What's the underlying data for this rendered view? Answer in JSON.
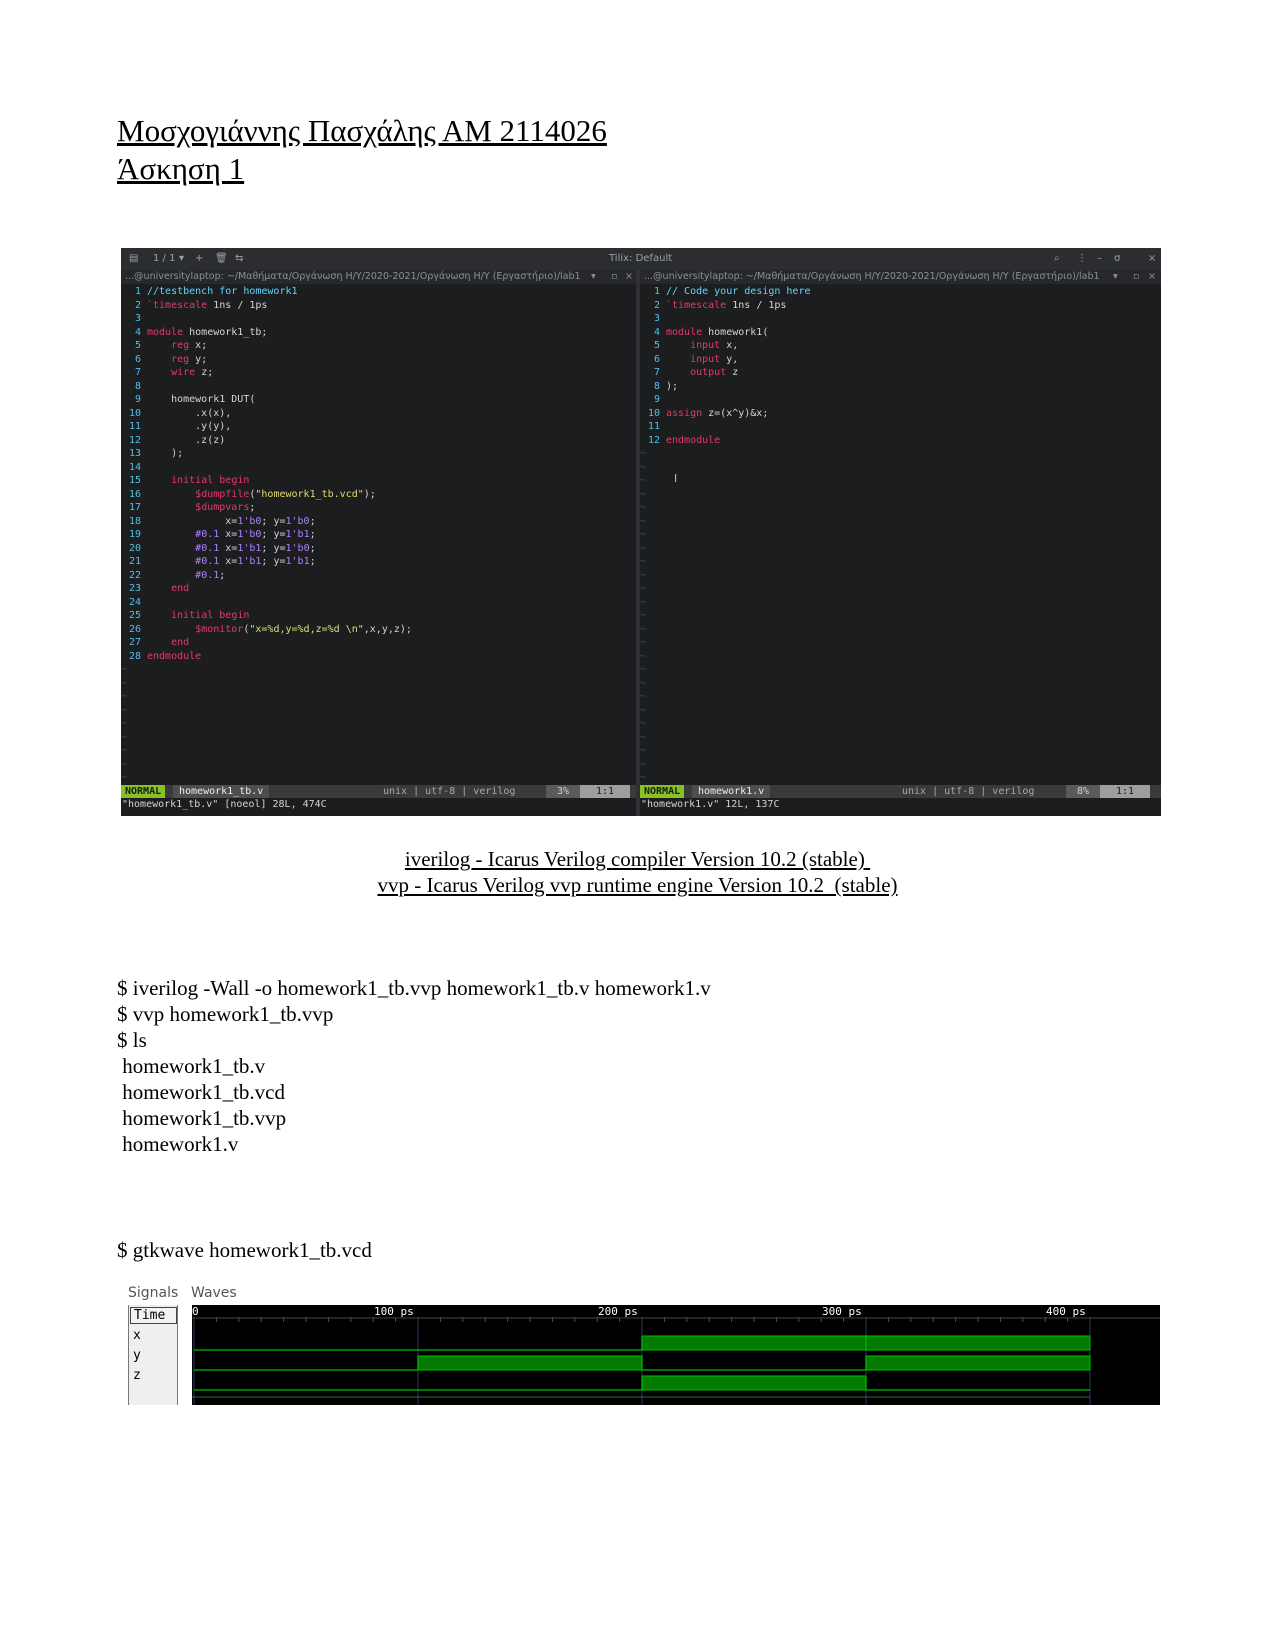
{
  "header": {
    "author_line": "Μοσχογιάννης Πασχάλης ΑΜ 2114026",
    "exercise_line": "Άσκηση 1"
  },
  "terminal": {
    "title": "Tilix: Default",
    "session_counter": "1 / 1",
    "left_pane": {
      "path": "...@universitylaptop: ~/Μαθήματα/Οργάνωση Η/Υ/2020-2021/Οργάνωση Η/Υ (Εργαστήριο)/lab1",
      "mode": "NORMAL",
      "file": "homework1_tb.v",
      "filetype": "unix | utf-8 | verilog",
      "percent": "3%",
      "position": "1:1",
      "message": "\"homework1_tb.v\" [noeol] 28L, 474C"
    },
    "right_pane": {
      "path": "...@universitylaptop: ~/Μαθήματα/Οργάνωση Η/Υ/2020-2021/Οργάνωση Η/Υ (Εργαστήριο)/lab1",
      "mode": "NORMAL",
      "file": "homework1.v",
      "filetype": "unix | utf-8 | verilog",
      "percent": "8%",
      "position": "1:1",
      "message": "\"homework1.v\" 12L, 137C"
    },
    "left_code": [
      "//testbench for homework1",
      "`timescale 1ns / 1ps",
      "",
      "module homework1_tb;",
      "    reg x;",
      "    reg y;",
      "    wire z;",
      "",
      "    homework1 DUT(",
      "        .x(x),",
      "        .y(y),",
      "        .z(z)",
      "    );",
      "",
      "    initial begin",
      "        $dumpfile(\"homework1_tb.vcd\");",
      "        $dumpvars;",
      "             x=1'b0; y=1'b0;",
      "        #0.1 x=1'b0; y=1'b1;",
      "        #0.1 x=1'b1; y=1'b0;",
      "        #0.1 x=1'b1; y=1'b1;",
      "        #0.1;",
      "    end",
      "",
      "    initial begin",
      "        $monitor(\"x=%d,y=%d,z=%d \\n\",x,y,z);",
      "    end",
      "endmodule"
    ],
    "right_code": [
      "// Code your design here",
      "`timescale 1ns / 1ps",
      "",
      "module homework1(",
      "    input x,",
      "    input y,",
      "    output z",
      ");",
      "",
      "assign z=(x^y)&x;",
      "",
      "endmodule"
    ]
  },
  "versions": {
    "iverilog": "iverilog - Icarus Verilog compiler Version 10.2 (stable) ",
    "vvp": "vvp - Icarus Verilog vvp runtime engine Version 10.2  (stable)"
  },
  "commands": {
    "compile": "$ iverilog -Wall -o homework1_tb.vvp homework1_tb.v homework1.v",
    "run": "$ vvp homework1_tb.vvp",
    "ls": "$ ls",
    "files": [
      " homework1_tb.v",
      " homework1_tb.vcd",
      " homework1_tb.vvp",
      " homework1.v"
    ],
    "gtkwave": "$ gtkwave homework1_tb.vcd"
  },
  "gtkwave": {
    "signals_label": "Signals",
    "waves_label": "Waves",
    "time_header": "Time",
    "signals": [
      "x",
      "y",
      "z"
    ],
    "time_ticks": [
      "0",
      "100 ps",
      "200 ps",
      "300 ps",
      "400 ps"
    ],
    "waveforms": {
      "x": [
        0,
        0,
        1,
        1
      ],
      "y": [
        0,
        1,
        0,
        1
      ],
      "z": [
        0,
        0,
        1,
        0
      ]
    },
    "wave_color": "#00c000"
  }
}
